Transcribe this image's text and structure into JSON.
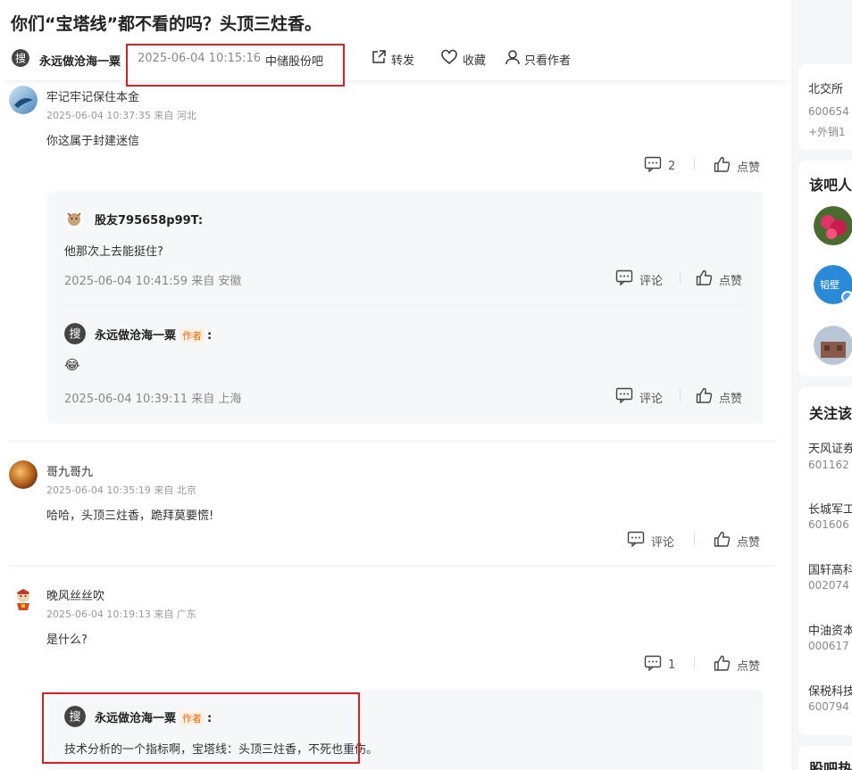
{
  "post": {
    "title": "你们“宝塔线”都不看的吗？头顶三炷香。",
    "author": "永远做沧海一粟",
    "time": "2025-06-04 10:15:16",
    "bar": "中储股份吧",
    "actions": {
      "share": "转发",
      "favorite": "收藏",
      "author_only": "只看作者"
    }
  },
  "comments": [
    {
      "name": "牢记牢记保住本金",
      "meta": "2025-06-04 10:37:35  来自 河北",
      "body": "你这属于封建迷信",
      "reply_count": "2",
      "like_label": "点赞",
      "replies": [
        {
          "name": "股友795658p99T:",
          "body": "他那次上去能挺住?",
          "meta": "2025-06-04 10:41:59  来自 安徽",
          "comment_label": "评论",
          "like_label": "点赞"
        },
        {
          "name": "永远做沧海一粟",
          "badge": "作者",
          "colon": ":",
          "body_emoji": "😂",
          "meta": "2025-06-04 10:39:11  来自 上海",
          "comment_label": "评论",
          "like_label": "点赞"
        }
      ]
    },
    {
      "name": "哥九哥九",
      "meta": "2025-06-04 10:35:19  来自 北京",
      "body": "哈哈，头顶三炷香，跪拜莫要慌!",
      "comment_label": "评论",
      "like_label": "点赞"
    },
    {
      "name": "晚风丝丝吹",
      "meta": "2025-06-04 10:19:13  来自 广东",
      "body": "是什么?",
      "reply_count": "1",
      "like_label": "点赞",
      "replies": [
        {
          "name": "永远做沧海一粟",
          "badge": "作者",
          "colon": ":",
          "body": "技术分析的一个指标啊，宝塔线：头顶三炷香，不死也重伤。"
        }
      ]
    }
  ],
  "sidebar": {
    "card1": {
      "text": "北交所",
      "code": "600654",
      "extra": "+外销1"
    },
    "people_title": "该吧人",
    "follow_title": "关注该",
    "follow_items": [
      {
        "name": "天风证券",
        "code": "601162"
      },
      {
        "name": "长城军工",
        "code": "601606"
      },
      {
        "name": "国轩高科",
        "code": "002074"
      },
      {
        "name": "中油资本",
        "code": "000617"
      },
      {
        "name": "保税科技",
        "code": "600794"
      }
    ],
    "hot_title": "股吧热"
  },
  "colors": {
    "accent": "#ff6a00",
    "highlight": "#e02020",
    "reply_bg": "#f6f7f9"
  }
}
